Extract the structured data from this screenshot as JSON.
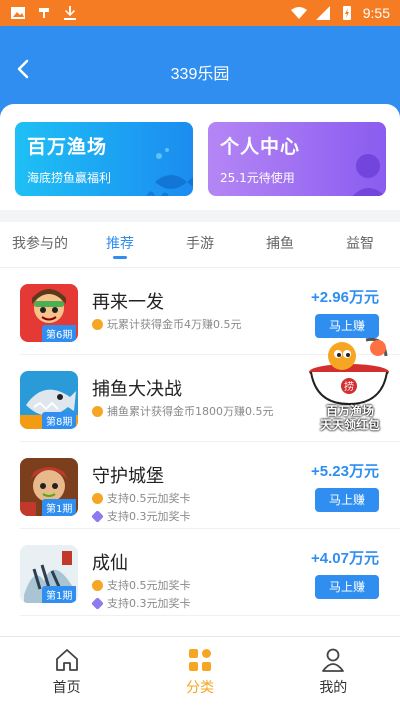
{
  "status_bar": {
    "time": "9:55",
    "left_icons": [
      "image-icon",
      "app-icon",
      "download-icon"
    ],
    "right_icons": [
      "wifi-icon",
      "signal-icon",
      "battery-charging-icon"
    ]
  },
  "header": {
    "title": "339乐园"
  },
  "cards": [
    {
      "title": "百万渔场",
      "subtitle": "海底捞鱼赢福利"
    },
    {
      "title": "个人中心",
      "subtitle": "25.1元待使用"
    }
  ],
  "tabs": [
    {
      "label": "我参与的",
      "active": false
    },
    {
      "label": "推荐",
      "active": true
    },
    {
      "label": "手游",
      "active": false
    },
    {
      "label": "捕鱼",
      "active": false
    },
    {
      "label": "益智",
      "active": false
    }
  ],
  "games": [
    {
      "name": "再来一发",
      "period": "第6期",
      "details": [
        "玩累计获得金币4万赚0.5元"
      ],
      "reward": "+2.96万元",
      "button": "马上赚"
    },
    {
      "name": "捕鱼大决战",
      "period": "第8期",
      "details": [
        "捕鱼累计获得金币1800万赚0.5元"
      ],
      "reward": "+",
      "button": ""
    },
    {
      "name": "守护城堡",
      "period": "第1期",
      "details": [
        "支持0.5元加奖卡",
        "支持0.3元加奖卡"
      ],
      "reward": "+5.23万元",
      "button": "马上赚"
    },
    {
      "name": "成仙",
      "period": "第1期",
      "details": [
        "支持0.5元加奖卡",
        "支持0.3元加奖卡"
      ],
      "reward": "+4.07万元",
      "button": "马上赚"
    }
  ],
  "float_promo": {
    "line1": "百万渔场",
    "line2": "天天领红包",
    "badge": "捞"
  },
  "bottom_nav": [
    {
      "label": "首页",
      "icon": "home-icon",
      "active": false
    },
    {
      "label": "分类",
      "icon": "category-grid-icon",
      "active": true
    },
    {
      "label": "我的",
      "icon": "user-icon",
      "active": false
    }
  ],
  "colors": {
    "status_bar": "#f57c22",
    "header": "#2f8ef0",
    "accent": "#2f8ef0",
    "nav_active": "#f5a623"
  }
}
